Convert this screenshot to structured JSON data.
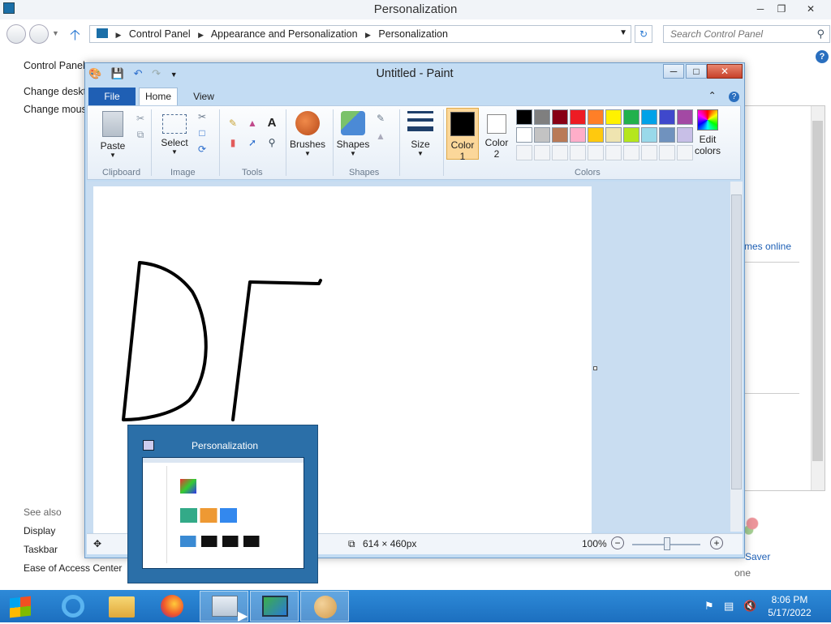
{
  "control_panel": {
    "title": "Personalization",
    "breadcrumb": [
      "Control Panel",
      "Appearance and Personalization",
      "Personalization"
    ],
    "search_placeholder": "Search Control Panel",
    "left_items": [
      "Control Panel",
      "Change deskto",
      "Change mous"
    ],
    "see_also_heading": "See also",
    "see_also_items": [
      "Display",
      "Taskbar",
      "Ease of Access Center"
    ],
    "right_link": "mes online",
    "screen_saver_label": "Saver",
    "screen_saver_value": "one"
  },
  "paint": {
    "title": "Untitled - Paint",
    "tabs": {
      "file": "File",
      "home": "Home",
      "view": "View"
    },
    "groups": {
      "clipboard": "Clipboard",
      "image": "Image",
      "tools": "Tools",
      "shapes": "Shapes",
      "colors": "Colors"
    },
    "buttons": {
      "paste": "Paste",
      "select": "Select",
      "brushes": "Brushes",
      "shapes": "Shapes",
      "size": "Size",
      "color1_line1": "Color",
      "color1_line2": "1",
      "color2_line1": "Color",
      "color2_line2": "2",
      "edit_colors_line1": "Edit",
      "edit_colors_line2": "colors"
    },
    "palette_row1": [
      "#000000",
      "#7f7f7f",
      "#880015",
      "#ed1c24",
      "#ff7f27",
      "#fff200",
      "#22b14c",
      "#00a2e8",
      "#3f48cc",
      "#a349a4"
    ],
    "palette_row2": [
      "#ffffff",
      "#c3c3c3",
      "#b97a57",
      "#ffaec9",
      "#ffc90e",
      "#efe4b0",
      "#b5e61d",
      "#99d9ea",
      "#7092be",
      "#c8bfe7"
    ],
    "color1": "#000000",
    "color2": "#ffffff",
    "status": {
      "canvas_size": "614 × 460px",
      "zoom": "100%"
    }
  },
  "thumbnail_popup": {
    "title": "Personalization"
  },
  "taskbar": {
    "clock_time": "8:06 PM",
    "clock_date": "5/17/2022"
  }
}
